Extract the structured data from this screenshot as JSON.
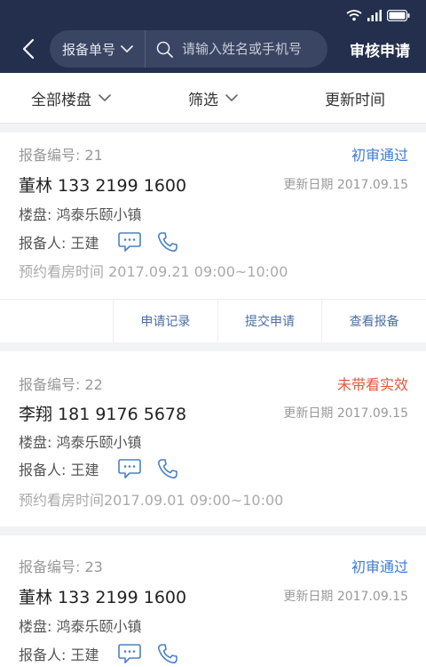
{
  "header": {
    "search_type_label": "报备单号",
    "search_placeholder": "请输入姓名或手机号",
    "review_button_label": "审核申请"
  },
  "filter_bar": {
    "all_properties_label": "全部楼盘",
    "filter_label": "筛选",
    "update_time_label": "更新时间"
  },
  "reports": [
    {
      "report_no": "报备编号: 21",
      "status": "初审通过",
      "name_phone": "董林 133 2199 1600",
      "update_date": "更新日期 2017.09.15",
      "property": "楼盘: 鸿泰乐颐小镇",
      "reporter": "报备人: 王建",
      "appointment": "预约看房时间 2017.09.21 09:00~10:00",
      "actions": [
        "申请记录",
        "提交申请",
        "查看报备"
      ]
    },
    {
      "report_no": "报备编号: 22",
      "status": "未带看实效",
      "name_phone": "李翔 181 9176 5678",
      "update_date": "更新日期 2017.09.15",
      "property": "楼盘: 鸿泰乐颐小镇",
      "reporter": "报备人: 王建",
      "appointment": "预约看房时间2017.09.01 09:00~10:00"
    },
    {
      "report_no": "报备编号: 23",
      "status": "初审通过",
      "name_phone": "董林 133 2199 1600",
      "update_date": "更新日期 2017.09.15",
      "property": "楼盘: 鸿泰乐颐小镇",
      "reporter": "报备人: 王建"
    }
  ],
  "colors": {
    "header_bg": "#232f4d",
    "status_pass": "#3c7bd2",
    "status_fail": "#e5573e",
    "icon_blue": "#4a80c8"
  },
  "icons": [
    "back-arrow-icon",
    "chevron-down-icon",
    "search-icon",
    "wifi-icon",
    "signal-icon",
    "battery-icon",
    "message-icon",
    "phone-icon"
  ]
}
